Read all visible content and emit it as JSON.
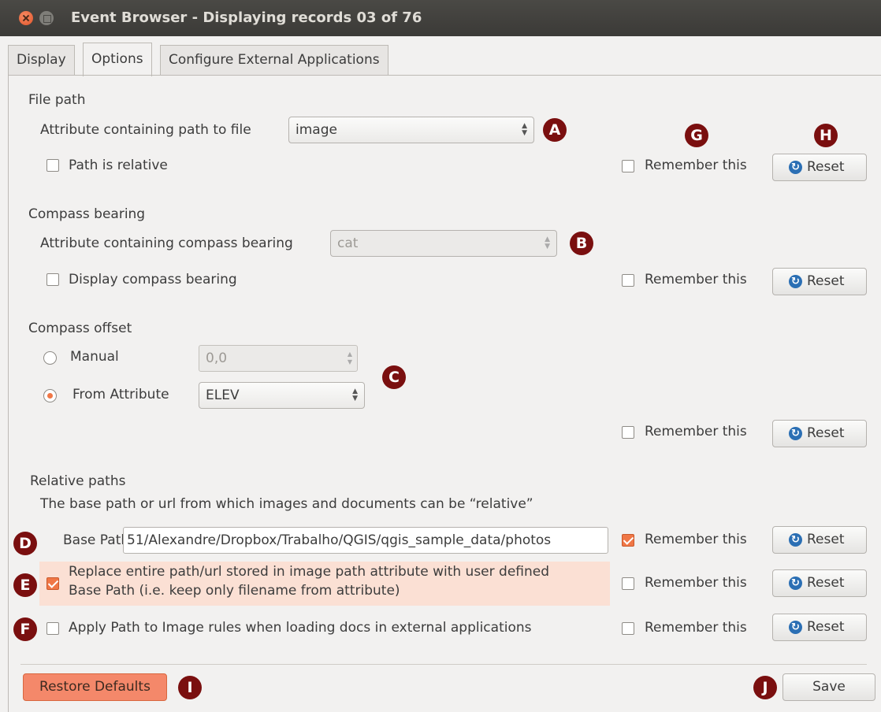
{
  "window": {
    "title": "Event Browser - Displaying records 03 of 76"
  },
  "tabs": [
    {
      "label": "Display"
    },
    {
      "label": "Options"
    },
    {
      "label": "Configure External Applications"
    }
  ],
  "file_path": {
    "section_label": "File path",
    "attribute_label": "Attribute containing path to file",
    "attribute_value": "image",
    "relative_checkbox_label": "Path is relative",
    "relative_checked": false
  },
  "compass_bearing": {
    "section_label": "Compass bearing",
    "attribute_label": "Attribute containing compass bearing",
    "attribute_value": "cat",
    "display_checkbox_label": "Display compass bearing",
    "display_checked": false
  },
  "compass_offset": {
    "section_label": "Compass offset",
    "manual_label": "Manual",
    "manual_value": "0,0",
    "from_attribute_label": "From Attribute",
    "from_attribute_value": "ELEV",
    "selected": "from_attribute"
  },
  "relative_paths": {
    "section_label": "Relative paths",
    "description": "The base path or url from which images and documents can be “relative”",
    "base_path_label": "Base Path",
    "base_path_value": "51/Alexandre/Dropbox/Trabalho/QGIS/qgis_sample_data/photos",
    "replace_label_line1": "Replace entire path/url stored in image path attribute with user defined",
    "replace_label_line2": "Base Path (i.e. keep only filename from attribute)",
    "replace_checked": true,
    "apply_label": "Apply Path to Image rules when loading docs in external applications",
    "apply_checked": false
  },
  "remember": {
    "label": "Remember this",
    "states": [
      false,
      false,
      false,
      true,
      false,
      false
    ]
  },
  "reset_label": "Reset",
  "markers": [
    "A",
    "B",
    "C",
    "D",
    "E",
    "F",
    "G",
    "H",
    "I",
    "J"
  ],
  "buttons": {
    "restore_defaults": "Restore Defaults",
    "save": "Save"
  },
  "colors": {
    "accent": "#f07746",
    "marker": "#7a0f0f",
    "highlight": "#fbe0d4"
  }
}
